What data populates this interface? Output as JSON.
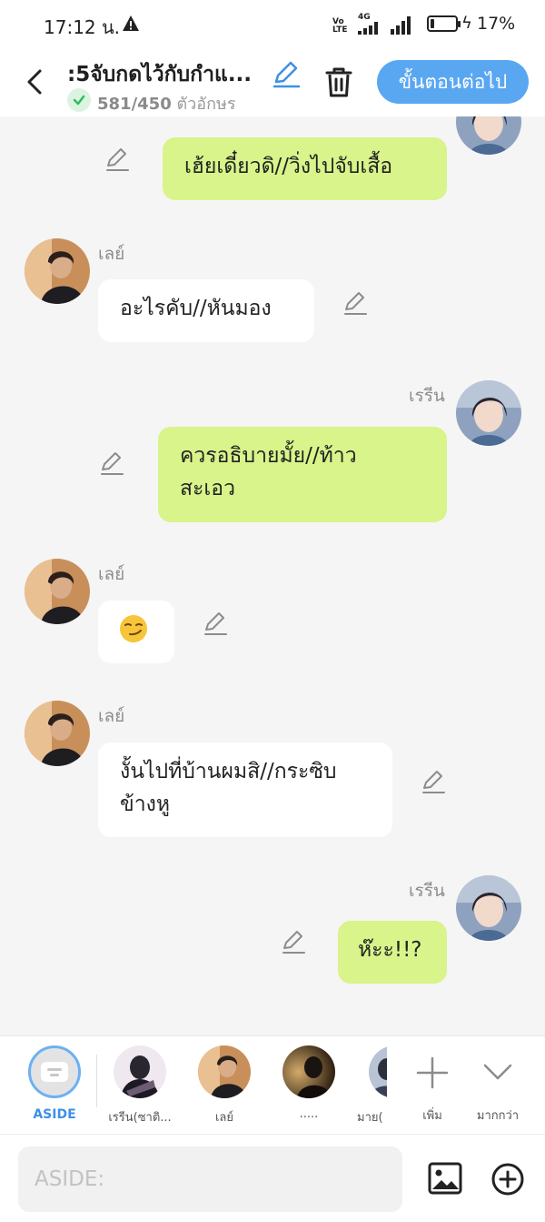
{
  "status_bar": {
    "time": "17:12 น.",
    "network": "4G",
    "volte": "Vo LTE",
    "battery_level": 0.17,
    "battery_text": "17%"
  },
  "header": {
    "title": ":5จับกดไว้กับกำแ...",
    "char_count": "581/450",
    "char_unit": "ตัวอักษร",
    "next_button": "ขั้นตอนต่อไป"
  },
  "messages": [
    {
      "side": "right",
      "sender": "",
      "text": "เฮ้ยเดี๋ยวดิ//วิ่งไปจับเสื้อ"
    },
    {
      "side": "left",
      "sender": "เลย์",
      "text": "อะไรคับ//หันมอง"
    },
    {
      "side": "right",
      "sender": "เรรีน",
      "text": "ควรอธิบายมั้ย//ท้าวสะเอว"
    },
    {
      "side": "left",
      "sender": "เลย์",
      "text": "😏"
    },
    {
      "side": "left",
      "sender": "เลย์",
      "text": "งั้นไปที่บ้านผมสิ//กระซิบข้างหู"
    },
    {
      "side": "right",
      "sender": "เรรีน",
      "text": "ห๊ะะ!!?"
    }
  ],
  "message_lines": {
    "m3": [
      "ควรอธิบายมั้ย//ท้าว",
      "สะเอว"
    ],
    "m5": [
      "งั้นไปที่บ้านผมสิ//กระซิบ",
      "ข้างหู"
    ]
  },
  "character_bar": {
    "aside_label": "ASIDE",
    "characters": [
      "เรรีน(ซาติ...",
      "เลย์",
      ".....",
      "มาย("
    ],
    "add_label": "เพิ่ม",
    "more_label": "มากกว่า"
  },
  "input": {
    "placeholder": "ASIDE:"
  },
  "colors": {
    "accent": "#5aa7f1",
    "bubble_right": "#d8f48a",
    "bubble_left": "#ffffff",
    "background": "#f5f5f5"
  },
  "icons": [
    "back-icon",
    "pencil-icon",
    "check-icon",
    "trash-icon",
    "image-icon",
    "plus-circle-icon",
    "plus-icon",
    "chevron-down-icon",
    "warning-icon"
  ]
}
